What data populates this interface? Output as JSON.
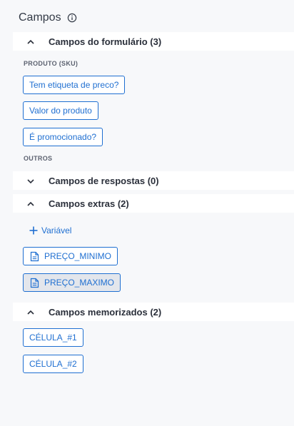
{
  "header": {
    "title": "Campos",
    "info_icon": "info-circle-icon"
  },
  "sections": {
    "form_fields": {
      "label": "Campos do formulário (3)",
      "expanded": true,
      "groups": [
        {
          "label": "PRODUTO (SKU)",
          "fields": [
            "Tem etiqueta de preco?",
            "Valor do produto",
            "É promocionado?"
          ]
        },
        {
          "label": "OUTROS",
          "fields": []
        }
      ]
    },
    "response_fields": {
      "label": "Campos de respostas (0)",
      "expanded": false
    },
    "extra_fields": {
      "label": "Campos extras (2)",
      "expanded": true,
      "add_label": "Variável",
      "fields": [
        {
          "label": "PREÇO_MINIMO",
          "icon": "document-icon",
          "selected": false
        },
        {
          "label": "PREÇO_MAXIMO",
          "icon": "document-icon",
          "selected": true
        }
      ]
    },
    "memorized_fields": {
      "label": "Campos memorizados (2)",
      "expanded": true,
      "fields": [
        "CÉLULA_#1",
        "CÉLULA_#2"
      ]
    }
  },
  "colors": {
    "accent": "#1f6fd1",
    "background": "#f7f8fa",
    "header_bg": "#ffffff",
    "selected_bg": "#e3e6ec"
  }
}
